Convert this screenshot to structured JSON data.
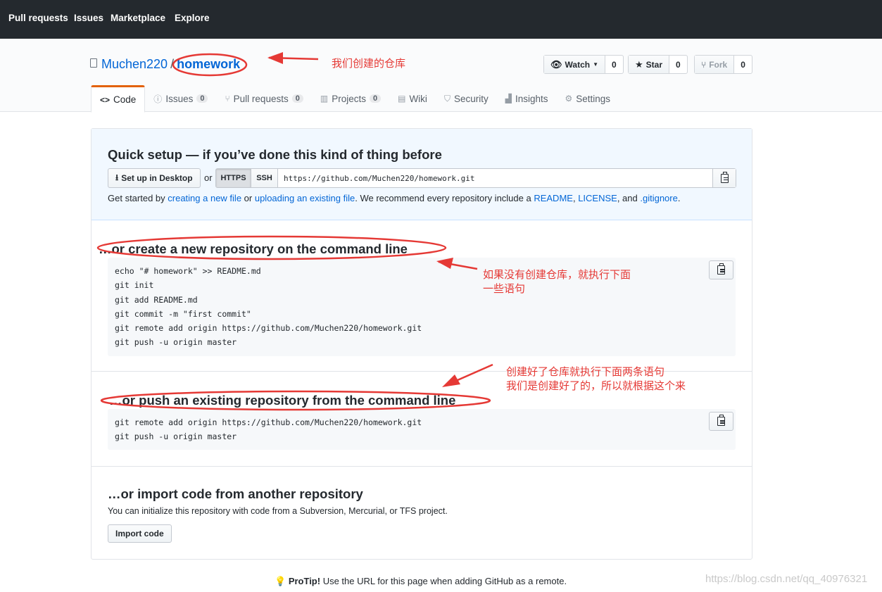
{
  "nav": {
    "items": [
      "Pull requests",
      "Issues",
      "Marketplace",
      "Explore"
    ]
  },
  "repo": {
    "owner": "Muchen220",
    "separator": "/",
    "name": "homework"
  },
  "social": {
    "watch": {
      "label": "Watch",
      "count": "0"
    },
    "star": {
      "label": "Star",
      "count": "0"
    },
    "fork": {
      "label": "Fork",
      "count": "0"
    }
  },
  "tabs": [
    {
      "label": "Code",
      "count": ""
    },
    {
      "label": "Issues",
      "count": "0"
    },
    {
      "label": "Pull requests",
      "count": "0"
    },
    {
      "label": "Projects",
      "count": "0"
    },
    {
      "label": "Wiki",
      "count": ""
    },
    {
      "label": "Security",
      "count": ""
    },
    {
      "label": "Insights",
      "count": ""
    },
    {
      "label": "Settings",
      "count": ""
    }
  ],
  "quick_setup": {
    "title": "Quick setup — if you’ve done this kind of thing before",
    "desktop_button": "Set up in Desktop",
    "or": "or",
    "https": "HTTPS",
    "ssh": "SSH",
    "url": "https://github.com/Muchen220/homework.git",
    "help": {
      "p1": "Get started by ",
      "link1": "creating a new file",
      "p2": " or ",
      "link2": "uploading an existing file",
      "p3": ". We recommend every repository include a ",
      "link3": "README",
      "p4": ", ",
      "link4": "LICENSE",
      "p5": ", and ",
      "link5": ".gitignore",
      "p6": "."
    }
  },
  "create_section": {
    "title": "…or create a new repository on the command line",
    "lines": [
      "echo \"# homework\" >> README.md",
      "git init",
      "git add README.md",
      "git commit -m \"first commit\"",
      "git remote add origin https://github.com/Muchen220/homework.git",
      "git push -u origin master"
    ]
  },
  "push_section": {
    "title": "…or push an existing repository from the command line",
    "lines": [
      "git remote add origin https://github.com/Muchen220/homework.git",
      "git push -u origin master"
    ]
  },
  "import_section": {
    "title": "…or import code from another repository",
    "description": "You can initialize this repository with code from a Subversion, Mercurial, or TFS project.",
    "button": "Import code"
  },
  "protip": {
    "bold": "ProTip!",
    "text": " Use the URL for this page when adding GitHub as a remote."
  },
  "annotations": {
    "repo_note": "我们创建的仓库",
    "create_note_1": "如果没有创建仓库，就执行下面",
    "create_note_2": "一些语句",
    "push_note_1": "创建好了仓库就执行下面两条语句",
    "push_note_2": "我们是创建好了的，所以就根据这个来"
  },
  "watermark": "https://blog.csdn.net/qq_40976321",
  "colors": {
    "header_bg": "#24292e",
    "link": "#0366d6",
    "annotation_red": "#e53935",
    "tab_accent": "#e36209"
  }
}
